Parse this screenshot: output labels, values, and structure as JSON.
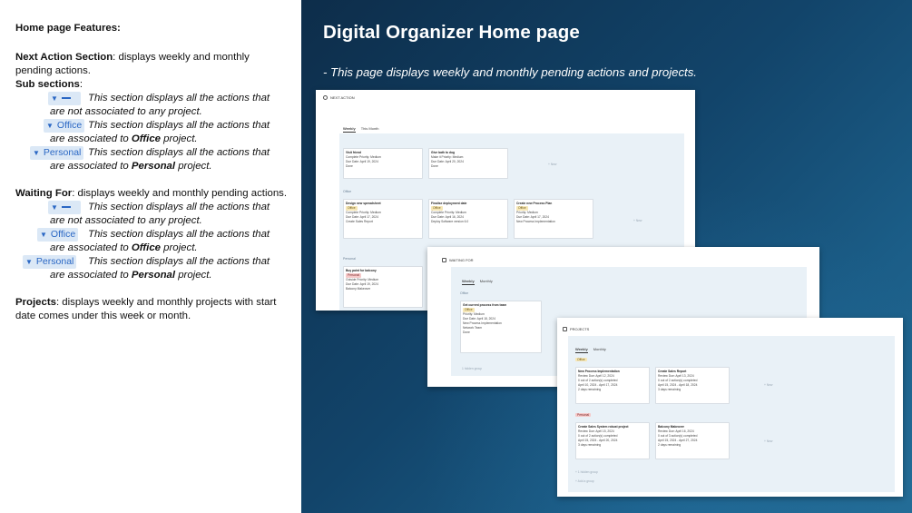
{
  "left": {
    "heading": "Home page Features:",
    "next_action": {
      "label": "Next Action Section",
      "text": ": displays weekly and monthly pending actions.",
      "sub_label": "Sub sections",
      "sub_colon": ":",
      "items": [
        {
          "chip": "",
          "line1": "This section displays all the actions that",
          "line2a": "are not associated to any project.",
          "bold": "",
          "line2b": ""
        },
        {
          "chip": "Office",
          "line1": "This section displays all the actions that",
          "line2a": "are associated to ",
          "bold": "Office",
          "line2b": " project."
        },
        {
          "chip": "Personal",
          "line1": "This section displays all the actions that",
          "line2a": "are associated to ",
          "bold": "Personal",
          "line2b": " project."
        }
      ]
    },
    "waiting_for": {
      "label": "Waiting For",
      "text": ": displays weekly and monthly pending actions.",
      "items": [
        {
          "chip": "",
          "line1": "This section displays all the actions that",
          "line2a": "are not associated to any project.",
          "bold": "",
          "line2b": ""
        },
        {
          "chip": "Office",
          "line1": "This section displays all the actions that",
          "line2a": "are associated to ",
          "bold": "Office",
          "line2b": " project."
        },
        {
          "chip": "Personal",
          "line1": "This section displays all the actions that",
          "line2a": "are associated to ",
          "bold": "Personal",
          "line2b": " project."
        }
      ]
    },
    "projects": {
      "label": "Projects",
      "text": ": displays weekly and monthly projects with start date comes under this week or month."
    }
  },
  "right": {
    "title": "Digital Organizer Home page",
    "subtitle": "- This page displays weekly and monthly pending actions and projects."
  },
  "shot1": {
    "title": "NEXT ACTION",
    "tab_weekly": "Weekly",
    "tab_month": "This Month",
    "group_office": "Office",
    "group_personal": "Personal",
    "cards": [
      {
        "name": "Visit friend",
        "meta1": "Complete  Priority: Medium",
        "meta2": "Due Date: April 19, 2024",
        "meta3": "Done"
      },
      {
        "name": "Give bath to dog",
        "meta1": "Make it  Priority: Medium",
        "meta2": "Due Date: April 20, 2024",
        "meta3": "Done"
      },
      {
        "name": "Design new spreadsheet",
        "tag": "Office",
        "meta1": "Complete  Priority: Medium",
        "meta2": "Due Date: April 17, 2024",
        "meta3": "Create Sales Report"
      },
      {
        "name": "Finalise deployment date",
        "tag": "Office",
        "meta1": "Complete  Priority: Medium",
        "meta2": "Due Date: April 16, 2024",
        "meta3": "Deploy Software version 6.0"
      },
      {
        "name": "Create new Process Plan",
        "tag": "Office",
        "meta1": "Priority: Medium",
        "meta2": "Due Date: April 17, 2024",
        "meta3": "New Process Implementation"
      },
      {
        "name": "Buy paint for balcony",
        "tag": "Personal",
        "meta1": "Outside  Priority: Medium",
        "meta2": "Due Date: April 19, 2024",
        "meta3": "Balcony Makeover"
      }
    ],
    "new_label": "+ New"
  },
  "shot2": {
    "title": "WAITING FOR",
    "tab_weekly": "Weekly",
    "tab_month": "Monthly",
    "group_office": "Office",
    "card": {
      "name": "Get current process from team",
      "tag": "Office",
      "meta1": "Priority: Medium",
      "meta2": "Due Date: April 18, 2024",
      "meta3": "New Process Implementation",
      "meta4": "Network Team",
      "meta5": "Done"
    },
    "hidden": "1 hidden group"
  },
  "shot3": {
    "title": "PROJECTS",
    "tab_weekly": "Weekly",
    "tab_month": "Monthly",
    "group_office": "Office",
    "group_personal": "Personal",
    "cards": [
      {
        "name": "New Process Implementation",
        "meta1": "Review Due: April 12, 2024",
        "meta2": "0 out of 2 action(s) completed",
        "meta3": "April 10, 2024 - April 17, 2024",
        "meta4": "2 days remaining"
      },
      {
        "name": "Create Sales Report",
        "meta1": "Review Due: April 13, 2024",
        "meta2": "0 out of 2 action(s) completed",
        "meta3": "April 15, 2024 - April 18, 2024",
        "meta4": "3 days remaining"
      },
      {
        "name": "Create Sales System robust project",
        "meta1": "Review Due: April 15, 2024",
        "meta2": "0 out of 2 action(s) completed",
        "meta3": "April 15, 2024 - April 20, 2024",
        "meta4": "3 days remaining"
      },
      {
        "name": "Balcony Makeover",
        "meta1": "Review Due: April 16, 2024",
        "meta2": "0 out of 3 action(s) completed",
        "meta3": "April 15, 2024 - April 27, 2024",
        "meta4": "2 days remaining"
      }
    ],
    "new_label": "+ New",
    "hidden": "+ 1 hidden group",
    "add_group": "+ Add a group"
  }
}
